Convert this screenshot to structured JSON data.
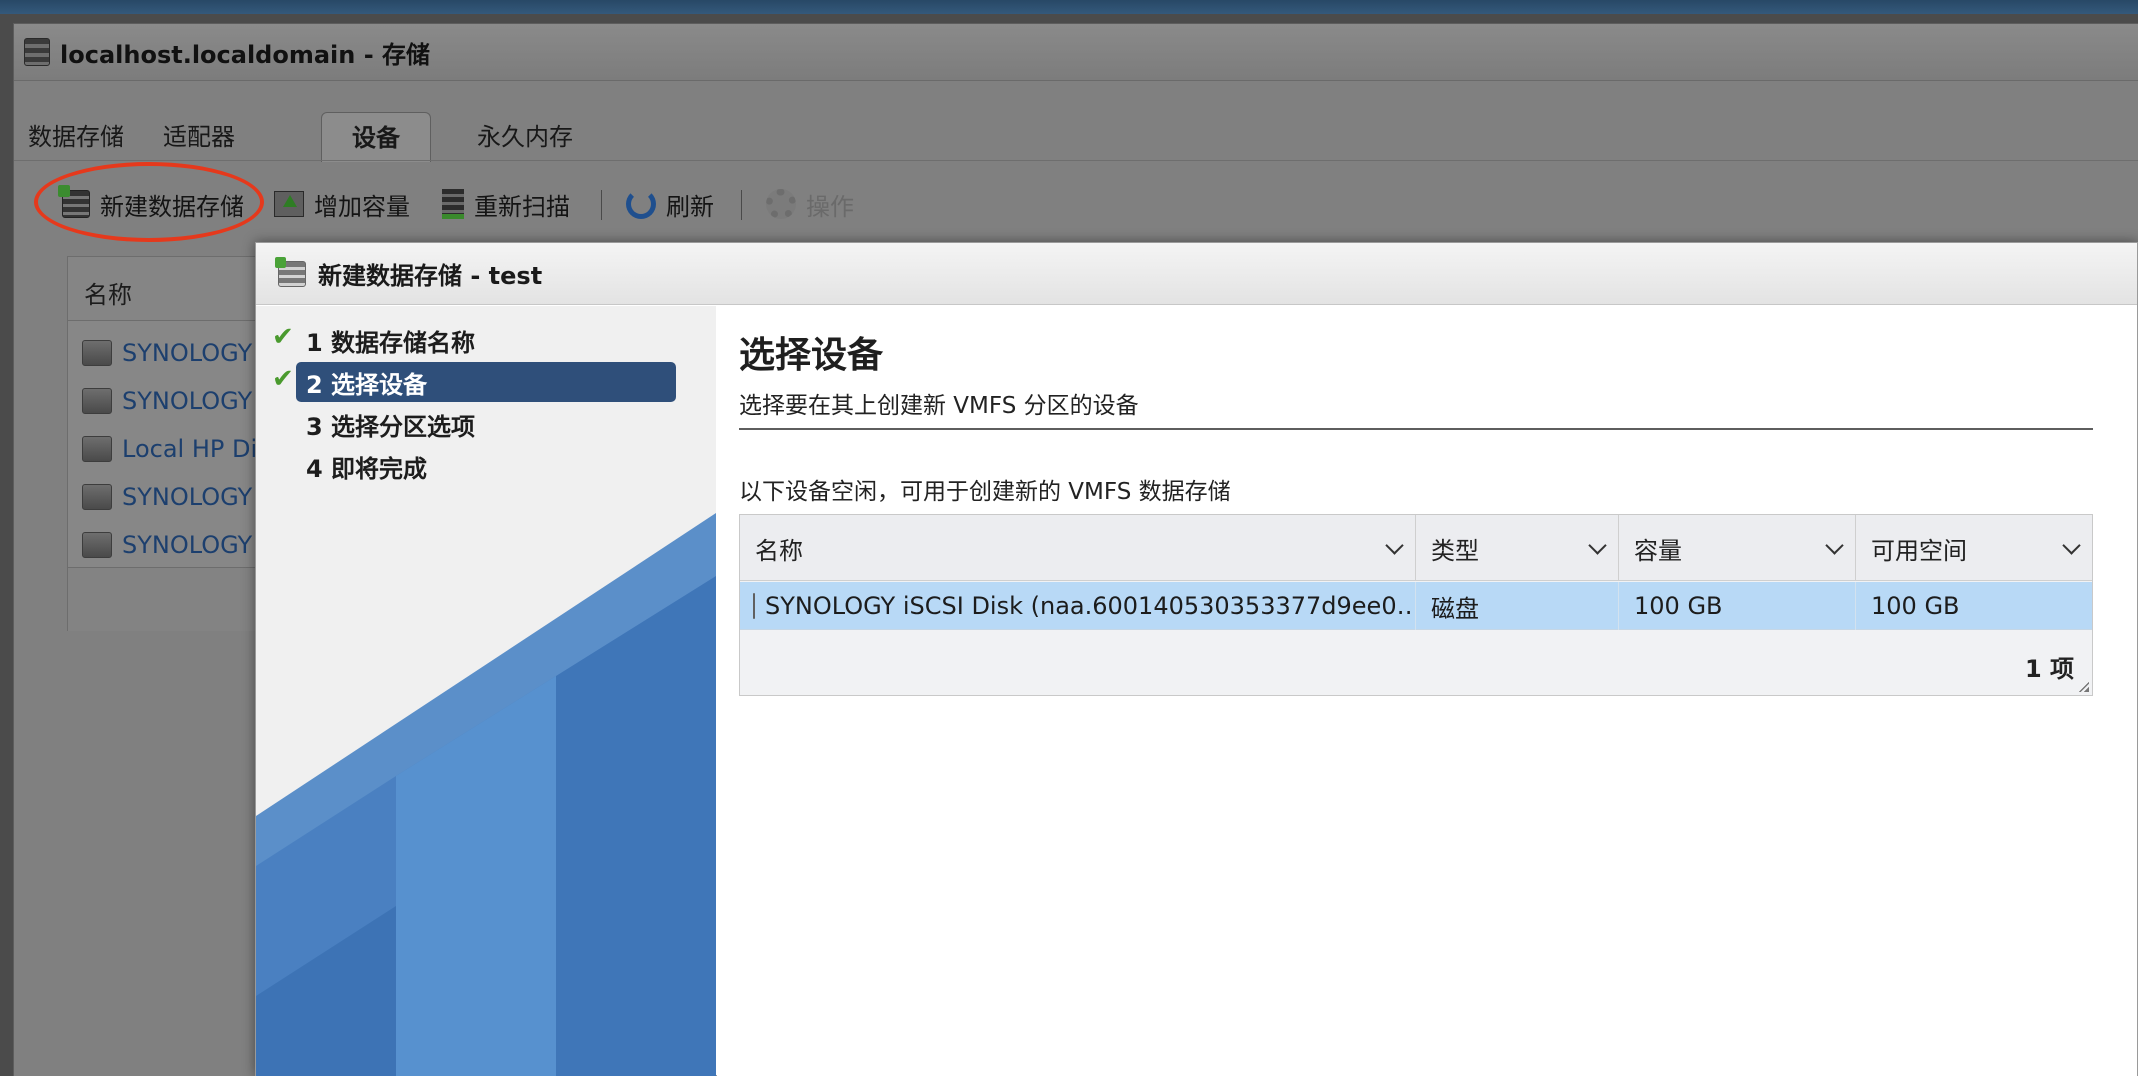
{
  "window": {
    "title": "localhost.localdomain - 存储"
  },
  "tabs": [
    {
      "label": "数据存储",
      "active": false
    },
    {
      "label": "适配器",
      "active": false
    },
    {
      "label": "设备",
      "active": true
    },
    {
      "label": "永久内存",
      "active": false
    }
  ],
  "toolbar": {
    "new_datastore": "新建数据存储",
    "increase_capacity": "增加容量",
    "rescan": "重新扫描",
    "refresh": "刷新",
    "actions": "操作"
  },
  "background_table": {
    "header_name": "名称",
    "rows": [
      "SYNOLOGY i",
      "SYNOLOGY i",
      "Local HP Disk",
      "SYNOLOGY i",
      "SYNOLOGY i"
    ]
  },
  "dialog": {
    "title": "新建数据存储 - test",
    "steps": [
      {
        "label": "1 数据存储名称",
        "done": true,
        "active": false
      },
      {
        "label": "2 选择设备",
        "done": true,
        "active": true
      },
      {
        "label": "3 选择分区选项",
        "done": false,
        "active": false
      },
      {
        "label": "4 即将完成",
        "done": false,
        "active": false
      }
    ],
    "heading": "选择设备",
    "subheading": "选择要在其上创建新 VMFS 分区的设备",
    "description": "以下设备空闲，可用于创建新的 VMFS 数据存储",
    "table": {
      "columns": [
        "名称",
        "类型",
        "容量",
        "可用空间"
      ],
      "rows": [
        {
          "name": "SYNOLOGY iSCSI Disk (naa.600140530353377d9ee0…",
          "type": "磁盘",
          "capacity": "100 GB",
          "free": "100 GB",
          "selected": true
        }
      ],
      "footer": "1 项"
    }
  },
  "colors": {
    "highlight_oval": "#e5391c",
    "active_step": "#2f4f7a",
    "selected_row": "#b8d9f6",
    "check": "#4a9a2e"
  }
}
